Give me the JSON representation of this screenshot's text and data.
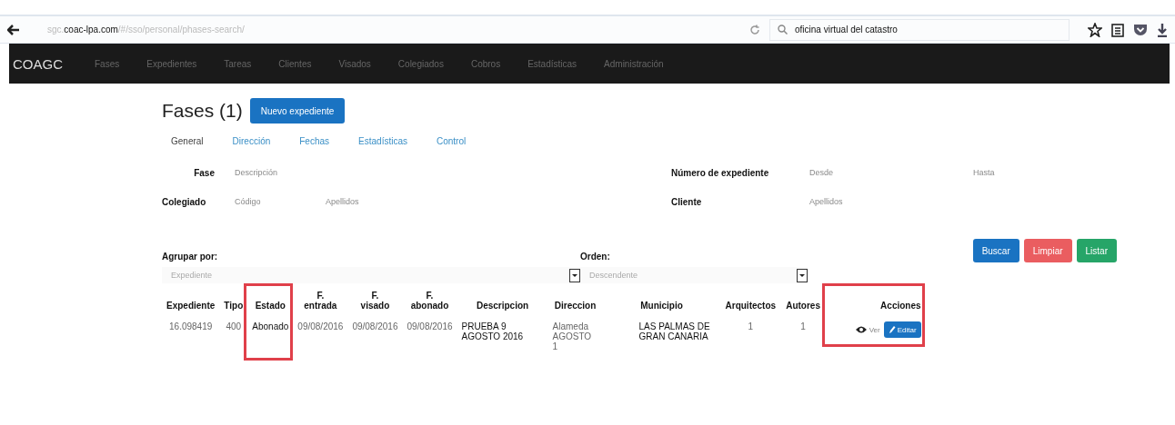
{
  "browser": {
    "url_prefix": "sgc.",
    "url_host": "coac-lpa.com",
    "url_path": "/#/sso/personal/phases-search/",
    "search": "oficina virtual del catastro"
  },
  "navbar": {
    "brand": "COAGC",
    "items": [
      {
        "label": "Fases"
      },
      {
        "label": "Expedientes"
      },
      {
        "label": "Tareas"
      },
      {
        "label": "Clientes"
      },
      {
        "label": "Visados"
      },
      {
        "label": "Colegiados"
      },
      {
        "label": "Cobros"
      },
      {
        "label": "Estadísticas"
      },
      {
        "label": "Administración"
      }
    ]
  },
  "page": {
    "title": "Fases (1)",
    "new_button": "Nuevo expediente"
  },
  "tabs": [
    {
      "label": "General",
      "selected": true
    },
    {
      "label": "Dirección",
      "selected": false
    },
    {
      "label": "Fechas",
      "selected": false
    },
    {
      "label": "Estadísticas",
      "selected": false
    },
    {
      "label": "Control",
      "selected": false
    }
  ],
  "filters": [
    {
      "label": "Fase",
      "fields": [
        {
          "placeholder": "Descripción"
        }
      ]
    },
    {
      "label": "Número de expediente",
      "fields": [
        {
          "placeholder": "Desde"
        },
        {
          "placeholder": "Hasta"
        }
      ]
    },
    {
      "label": "Colegiado",
      "fields": [
        {
          "placeholder": "Código"
        },
        {
          "placeholder": "Apellidos"
        }
      ]
    },
    {
      "label": "Cliente",
      "fields": [
        {
          "placeholder": "Apellidos"
        }
      ]
    }
  ],
  "actions": [
    {
      "label": "Buscar",
      "kind": "primary"
    },
    {
      "label": "Limpiar",
      "kind": "danger"
    },
    {
      "label": "Listar",
      "kind": "success"
    }
  ],
  "grouping": [
    {
      "label": "Agrupar por:",
      "value": "Expediente"
    },
    {
      "label": "Orden:",
      "value": "Descendente"
    }
  ],
  "table": {
    "columns": [
      {
        "label": "Expediente",
        "highlighted": false
      },
      {
        "label": "Tipo",
        "highlighted": false
      },
      {
        "label": "Estado",
        "highlighted": true
      },
      {
        "label": "F. entrada",
        "highlighted": false
      },
      {
        "label": "F. visado",
        "highlighted": false
      },
      {
        "label": "F. abonado",
        "highlighted": false
      },
      {
        "label": "Descripcion",
        "highlighted": false
      },
      {
        "label": "Direccion",
        "highlighted": false
      },
      {
        "label": "Municipio",
        "highlighted": false
      },
      {
        "label": "Arquitectos",
        "highlighted": false
      },
      {
        "label": "Autores",
        "highlighted": false
      },
      {
        "label": "Acciones",
        "highlighted": true
      }
    ],
    "rows": [
      {
        "cells": [
          "16.098419",
          "400",
          "Abonado",
          "09/08/2016",
          "09/08/2016",
          "09/08/2016",
          "PRUEBA 9 AGOSTO 2016",
          "Alameda AGOSTO 1",
          "LAS PALMAS DE GRAN CANARIA",
          "1",
          "1"
        ],
        "view": "Ver",
        "edit": "Editar"
      }
    ]
  }
}
